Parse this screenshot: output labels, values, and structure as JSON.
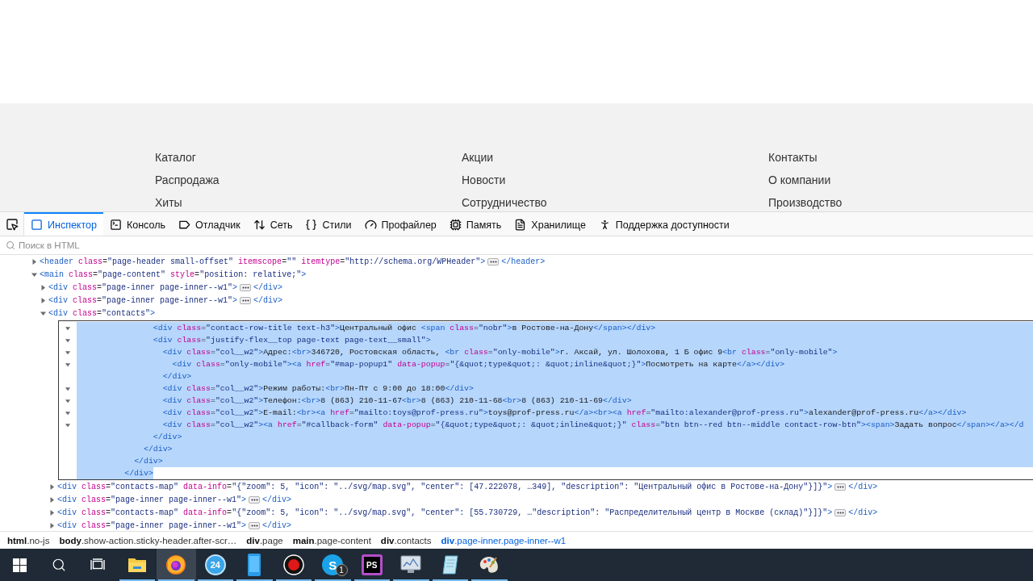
{
  "site_footer": {
    "columns": [
      [
        "Каталог",
        "Распродажа",
        "Хиты"
      ],
      [
        "Акции",
        "Новости",
        "Сотрудничество"
      ],
      [
        "Контакты",
        "О компании",
        "Производство"
      ]
    ]
  },
  "devtools_tabs": [
    {
      "kind": "inspector",
      "label": "Инспектор",
      "selected": true
    },
    {
      "kind": "console",
      "label": "Консоль",
      "selected": false
    },
    {
      "kind": "debugger",
      "label": "Отладчик",
      "selected": false
    },
    {
      "kind": "network",
      "label": "Сеть",
      "selected": false
    },
    {
      "kind": "styles",
      "label": "Стили",
      "selected": false
    },
    {
      "kind": "profiler",
      "label": "Профайлер",
      "selected": false
    },
    {
      "kind": "memory",
      "label": "Память",
      "selected": false
    },
    {
      "kind": "storage",
      "label": "Хранилище",
      "selected": false
    },
    {
      "kind": "accessibility",
      "label": "Поддержка доступности",
      "selected": false
    }
  ],
  "inspector": {
    "search": {
      "placeholder": "Поиск в HTML"
    },
    "tree": [
      {
        "kind": "node",
        "expanded": false,
        "text": "<header class=\"page-header small-offset\" itemscope=\"\" itemtype=\"http://schema.org/WPHeader\">",
        "more": true,
        "tail": "</header>"
      },
      {
        "kind": "node",
        "expanded": true,
        "text": "<main class=\"page-content\" style=\"position: relative;\">",
        "children": [
          {
            "kind": "node",
            "expanded": false,
            "text": "<div class=\"page-inner page-inner--w1\">",
            "more": true,
            "tail": "</div>"
          },
          {
            "kind": "node",
            "expanded": false,
            "text": "<div class=\"page-inner page-inner--w1\">",
            "more": true,
            "tail": "</div>"
          },
          {
            "kind": "node",
            "expanded": true,
            "text": "<div class=\"contacts\">",
            "children": [
              {
                "kind": "editor",
                "lines": [
                  {
                    "text": "                <div class=\"contact-row-title text-h3\">Центральный офис <span class=\"nobr\">в Ростове-на-Дону</span></div>",
                    "fold": true,
                    "selected": true
                  },
                  {
                    "text": "                <div class=\"justify-flex__top page-text page-text__small\">",
                    "fold": true,
                    "selected": true
                  },
                  {
                    "text": "                  <div class=\"col__w2\">Адрес:<br>346720, Ростовская область, <br class=\"only-mobile\">г. Аксай, ул. Шолохова, 1 Б офис 9<br class=\"only-mobile\">",
                    "fold": true,
                    "selected": true
                  },
                  {
                    "text": "                    <div class=\"only-mobile\"><a href=\"#map-popup1\" data-popup=\"{&quot;type&quot;: &quot;inline&quot;}\">Посмотреть на карте</a></div>",
                    "fold": true,
                    "selected": true
                  },
                  {
                    "text": "                  </div>",
                    "fold": false,
                    "selected": true
                  },
                  {
                    "text": "                  <div class=\"col__w2\">Режим работы:<br>Пн-Пт с 9:00 до 18:00</div>",
                    "fold": true,
                    "selected": true
                  },
                  {
                    "text": "                  <div class=\"col__w2\">Телефон:<br>8 (863) 210-11-67<br>8 (863) 210-11-68<br>8 (863) 210-11-69</div>",
                    "fold": true,
                    "selected": true
                  },
                  {
                    "text": "                  <div class=\"col__w2\">E-mail:<br><a href=\"mailto:toys@prof-press.ru\">toys@prof-press.ru</a><br><a href=\"mailto:alexander@prof-press.ru\">alexander@prof-press.ru</a></div>",
                    "fold": true,
                    "selected": true
                  },
                  {
                    "text": "                  <div class=\"col__w2\"><a href=\"#callback-form\" data-popup=\"{&quot;type&quot;: &quot;inline&quot;}\" class=\"btn btn--red btn--middle contact-row-btn\"><span>Задать вопрос</span></a></d",
                    "fold": true,
                    "selected": true
                  },
                  {
                    "text": "                </div>",
                    "fold": false,
                    "selected": true
                  },
                  {
                    "text": "              </div>",
                    "fold": false,
                    "selected": true
                  },
                  {
                    "text": "            </div>",
                    "fold": false,
                    "selected": true
                  },
                  {
                    "text": "          </div>",
                    "fold": false,
                    "selected": true
                  }
                ]
              },
              {
                "kind": "node",
                "expanded": false,
                "text": "<div class=\"contacts-map\" data-info=\"{\"zoom\": 5, \"icon\": \"../svg/map.svg\", \"center\": [47.222078, …349], \"description\": \"Центральный офис в Ростове-на-Дону\"}]}\">",
                "more": true,
                "tail": "</div>"
              },
              {
                "kind": "node",
                "expanded": false,
                "text": "<div class=\"page-inner page-inner--w1\">",
                "more": true,
                "tail": "</div>"
              },
              {
                "kind": "node",
                "expanded": false,
                "text": "<div class=\"contacts-map\" data-info=\"{\"zoom\": 5, \"icon\": \"../svg/map.svg\", \"center\": [55.730729, …\"description\": \"Распределительный центр в Москве (склад)\"}]}\">",
                "more": true,
                "tail": "</div>"
              },
              {
                "kind": "node",
                "expanded": false,
                "text": "<div class=\"page-inner page-inner--w1\">",
                "more": true,
                "tail": "</div>"
              }
            ]
          }
        ]
      }
    ],
    "breadcrumbs": [
      {
        "tag": "html",
        "cls": ".no-js",
        "selected": false
      },
      {
        "tag": "body",
        "cls": ".show-action.sticky-header.after-scr…",
        "selected": false
      },
      {
        "tag": "div",
        "cls": ".page",
        "selected": false
      },
      {
        "tag": "main",
        "cls": ".page-content",
        "selected": false
      },
      {
        "tag": "div",
        "cls": ".contacts",
        "selected": false
      },
      {
        "tag": "div",
        "cls": ".page-inner.page-inner--w1",
        "selected": true
      }
    ]
  },
  "taskbar": [
    {
      "kind": "windows"
    },
    {
      "kind": "search"
    },
    {
      "kind": "taskview"
    },
    {
      "kind": "folder",
      "running": true,
      "selected": false
    },
    {
      "kind": "firefox",
      "running": true,
      "selected": true
    },
    {
      "kind": "calendar",
      "label": "24",
      "running": true,
      "selected": false
    },
    {
      "kind": "phone",
      "running": true,
      "selected": false
    },
    {
      "kind": "record",
      "running": true,
      "selected": false
    },
    {
      "kind": "skype",
      "label": "S",
      "badge": "1",
      "running": true,
      "selected": false
    },
    {
      "kind": "phpstorm",
      "label": "PS",
      "running": true,
      "selected": false
    },
    {
      "kind": "monitor",
      "running": true,
      "selected": false
    },
    {
      "kind": "notepad",
      "running": true,
      "selected": false
    },
    {
      "kind": "paint",
      "running": true,
      "selected": false
    }
  ]
}
